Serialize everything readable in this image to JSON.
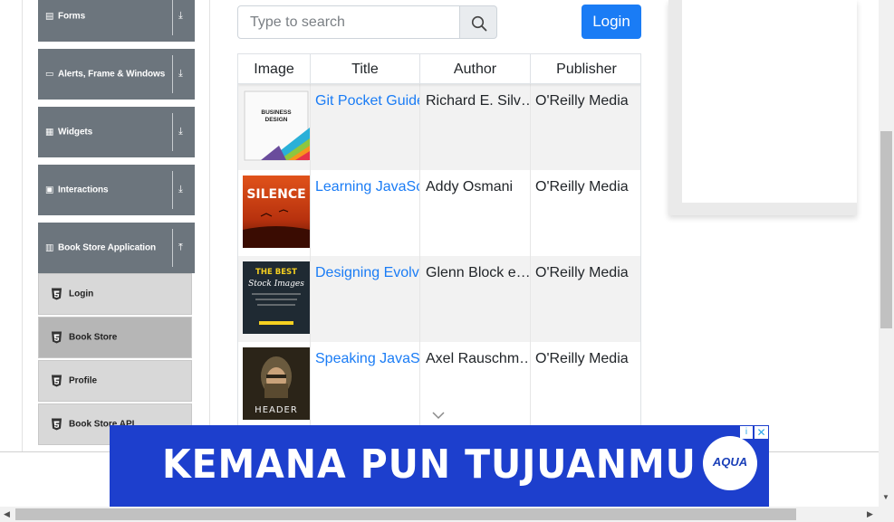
{
  "sidebar": {
    "groups": [
      {
        "label": "Forms",
        "icon": "form-icon",
        "arrow": "⤓"
      },
      {
        "label": "Alerts, Frame & Windows",
        "icon": "window-icon",
        "arrow": "⤓"
      },
      {
        "label": "Widgets",
        "icon": "grid-icon",
        "arrow": "⤓"
      },
      {
        "label": "Interactions",
        "icon": "interaction-icon",
        "arrow": "⤓"
      },
      {
        "label": "Book Store Application",
        "icon": "books-icon",
        "arrow": "⤒"
      }
    ],
    "items": [
      {
        "label": "Login"
      },
      {
        "label": "Book Store"
      },
      {
        "label": "Profile"
      },
      {
        "label": "Book Store API"
      }
    ]
  },
  "search": {
    "placeholder": "Type to search",
    "value": ""
  },
  "login_label": "Login",
  "table": {
    "headers": [
      "Image",
      "Title",
      "Author",
      "Publisher"
    ],
    "rows": [
      {
        "title": "Git Pocket Guide",
        "author": "Richard E. Silv…",
        "publisher": "O'Reilly Media",
        "cover_text": "BUSINESS DESIGN"
      },
      {
        "title": "Learning JavaScript Design Patterns",
        "author": "Addy Osmani",
        "publisher": "O'Reilly Media",
        "cover_text": "SILENCE"
      },
      {
        "title": "Designing Evolvable Web APIs with ASP.NET",
        "author": "Glenn Block e…",
        "publisher": "O'Reilly Media",
        "cover_text": "THE BEST Stock Images"
      },
      {
        "title": "Speaking JavaScript",
        "author": "Axel Rauschm…",
        "publisher": "O'Reilly Media",
        "cover_text": "HEADER"
      }
    ]
  },
  "ad": {
    "headline": "KEMANA PUN TUJUANMU",
    "brand": "AQUA",
    "info": "i",
    "close": "✕"
  },
  "colors": {
    "primary": "#1a7cf5",
    "sidebar_group": "#6c757d",
    "ad_bg": "#1d3fcd"
  }
}
